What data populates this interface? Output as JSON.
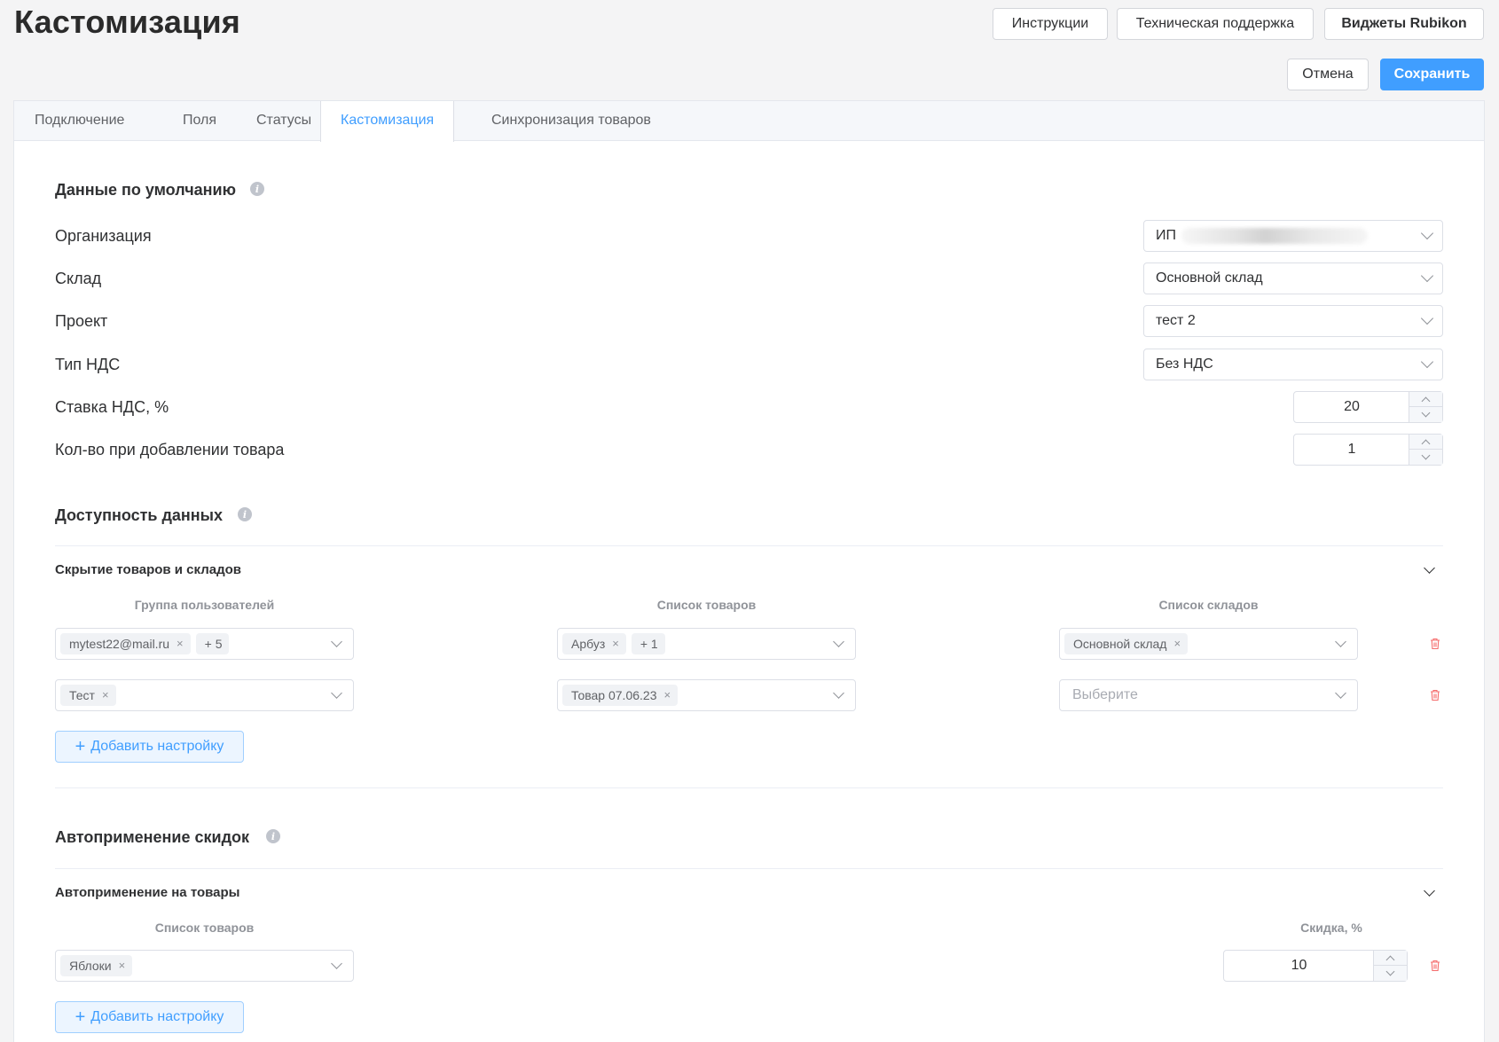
{
  "page": {
    "title": "Кастомизация"
  },
  "header": {
    "instructions_label": "Инструкции",
    "support_label": "Техническая поддержка",
    "widgets_label": "Виджеты Rubikon",
    "cancel_label": "Отмена",
    "save_label": "Сохранить"
  },
  "tabs": [
    {
      "label": "Подключение"
    },
    {
      "label": "Поля"
    },
    {
      "label": "Статусы"
    },
    {
      "label": "Кастомизация"
    },
    {
      "label": "Синхронизация товаров"
    }
  ],
  "defaults": {
    "title": "Данные по умолчанию",
    "organization_label": "Организация",
    "organization_value": "ИП",
    "warehouse_label": "Склад",
    "warehouse_value": "Основной склад",
    "project_label": "Проект",
    "project_value": "тест 2",
    "vat_type_label": "Тип НДС",
    "vat_type_value": "Без НДС",
    "vat_rate_label": "Ставка НДС, %",
    "vat_rate_value": "20",
    "qty_label": "Кол-во при добавлении товара",
    "qty_value": "1"
  },
  "availability": {
    "title": "Доступность данных",
    "subsection_title": "Скрытие товаров и складов",
    "col_groups": "Группа пользователей",
    "col_products": "Список товаров",
    "col_warehouses": "Список складов",
    "rows": [
      {
        "group_tag": "mytest22@mail.ru",
        "group_more": "+ 5",
        "product_tag": "Арбуз",
        "product_more": "+ 1",
        "warehouse_tag": "Основной склад"
      },
      {
        "group_tag": "Тест",
        "product_tag": "Товар 07.06.23",
        "warehouse_placeholder": "Выберите"
      }
    ],
    "add_label": "Добавить настройку"
  },
  "discounts": {
    "title": "Автоприменение скидок",
    "subsection_title": "Автоприменение на товары",
    "col_products": "Список товаров",
    "col_discount": "Скидка, %",
    "rows": [
      {
        "product_tag": "Яблоки",
        "discount": "10"
      }
    ],
    "add_label": "Добавить настройку"
  },
  "icons": {
    "tag_close": "×",
    "info": "i",
    "plus": "+"
  },
  "colors": {
    "accent": "#409eff",
    "danger": "#f56c6c",
    "background": "#f4f4f5"
  }
}
